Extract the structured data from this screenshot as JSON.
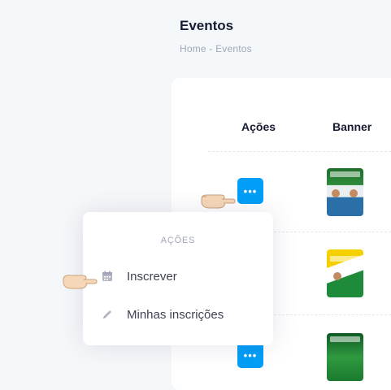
{
  "page": {
    "title": "Eventos",
    "breadcrumb": "Home - Eventos"
  },
  "table": {
    "columns": [
      "Ações",
      "Banner"
    ],
    "rows": [
      {
        "action_label": "•••"
      },
      {
        "action_label": ""
      },
      {
        "action_label": "•••"
      }
    ]
  },
  "dropdown": {
    "header": "AÇÕES",
    "items": [
      {
        "label": "Inscrever",
        "icon": "calendar-icon"
      },
      {
        "label": "Minhas inscrições",
        "icon": "pencil-icon"
      }
    ]
  },
  "colors": {
    "primary": "#009ef7",
    "title": "#181c32",
    "muted": "#a1a5b7",
    "background": "#f5f8fa"
  }
}
